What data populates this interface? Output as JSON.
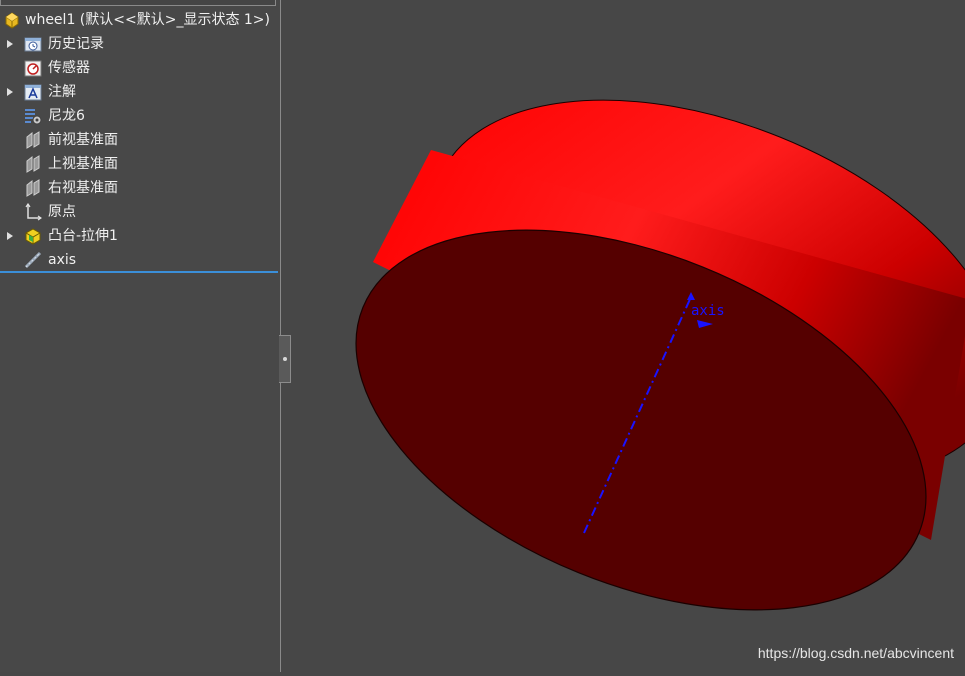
{
  "tree": {
    "root": {
      "label": "wheel1  (默认<<默认>_显示状态 1>)",
      "icon": "part-icon"
    },
    "items": [
      {
        "label": "历史记录",
        "icon": "history-folder-icon",
        "expandable": true
      },
      {
        "label": "传感器",
        "icon": "sensor-icon",
        "expandable": false
      },
      {
        "label": "注解",
        "icon": "annotations-icon",
        "expandable": true
      },
      {
        "label": "尼龙6",
        "icon": "material-icon",
        "expandable": false
      },
      {
        "label": "前视基准面",
        "icon": "plane-icon",
        "expandable": false
      },
      {
        "label": "上视基准面",
        "icon": "plane-icon",
        "expandable": false
      },
      {
        "label": "右视基准面",
        "icon": "plane-icon",
        "expandable": false
      },
      {
        "label": "原点",
        "icon": "origin-icon",
        "expandable": false
      },
      {
        "label": "凸台-拉伸1",
        "icon": "boss-extrude-icon",
        "expandable": true
      },
      {
        "label": "axis",
        "icon": "axis-icon",
        "expandable": false
      }
    ]
  },
  "viewport": {
    "axis_label": "axis",
    "colors": {
      "background": "#474747",
      "cylinder_side": "#e00000",
      "cylinder_face": "#550000",
      "axis": "#1a12ff"
    }
  },
  "watermark": "https://blog.csdn.net/abcvincent"
}
